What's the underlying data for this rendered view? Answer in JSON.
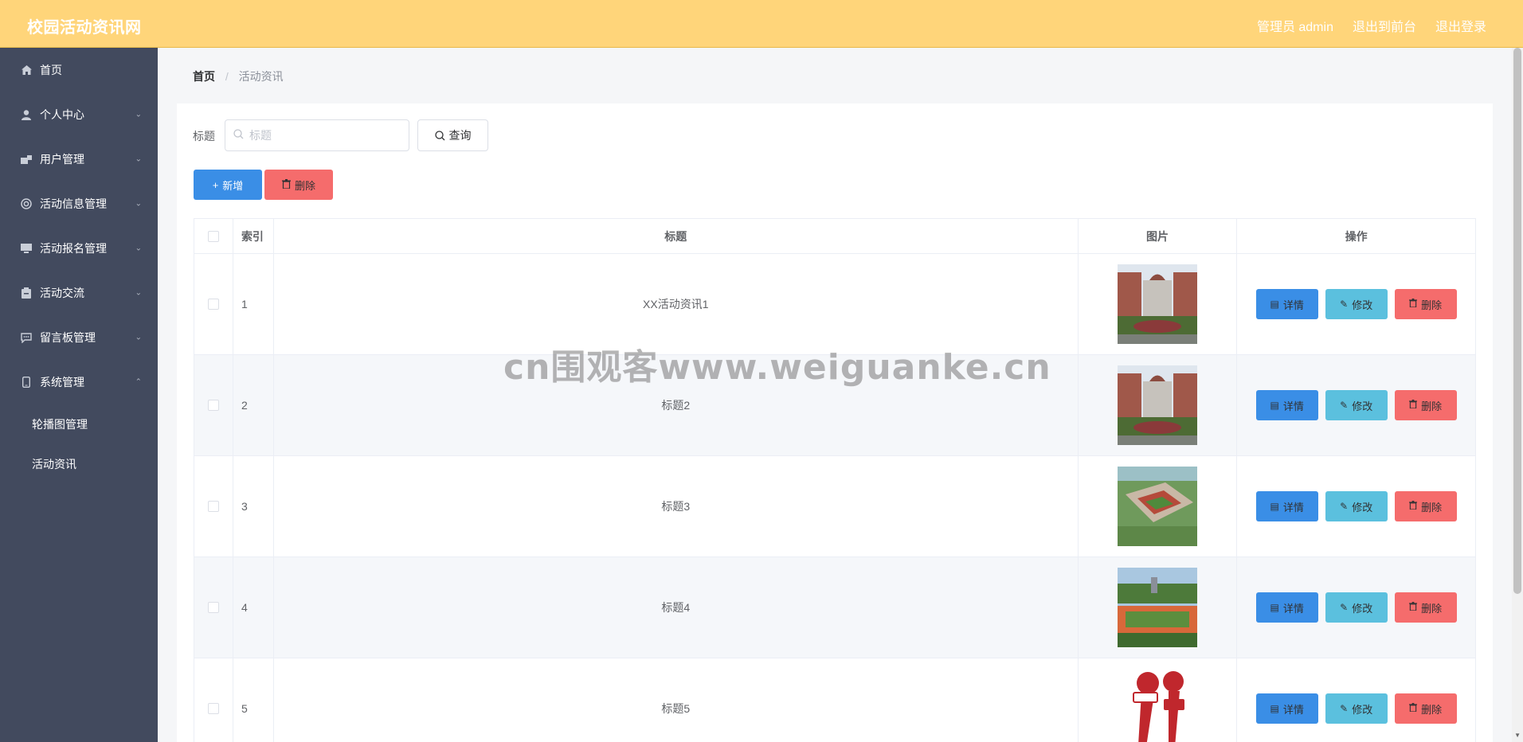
{
  "header": {
    "title": "校园活动资讯网",
    "admin_label": "管理员 admin",
    "front_link": "退出到前台",
    "logout_link": "退出登录"
  },
  "sidebar": {
    "items": [
      {
        "label": "首页",
        "icon": "home-icon",
        "expandable": false
      },
      {
        "label": "个人中心",
        "icon": "user-icon",
        "expandable": true
      },
      {
        "label": "用户管理",
        "icon": "users-icon",
        "expandable": true
      },
      {
        "label": "活动信息管理",
        "icon": "lifebuoy-icon",
        "expandable": true
      },
      {
        "label": "活动报名管理",
        "icon": "monitor-icon",
        "expandable": true
      },
      {
        "label": "活动交流",
        "icon": "clipboard-icon",
        "expandable": true
      },
      {
        "label": "留言板管理",
        "icon": "chat-icon",
        "expandable": true
      },
      {
        "label": "系统管理",
        "icon": "phone-icon",
        "expandable": true,
        "expanded": true
      }
    ],
    "sub_items": [
      {
        "label": "轮播图管理"
      },
      {
        "label": "活动资讯"
      }
    ]
  },
  "breadcrumb": {
    "home": "首页",
    "separator": "/",
    "current": "活动资讯"
  },
  "search": {
    "label": "标题",
    "placeholder": "标题",
    "value": "",
    "query_button": "查询"
  },
  "actions": {
    "add_button": "新增",
    "delete_button": "删除"
  },
  "table": {
    "columns": [
      "索引",
      "标题",
      "图片",
      "操作"
    ],
    "rows": [
      {
        "index": "1",
        "title": "XX活动资讯1",
        "image": "campus-building"
      },
      {
        "index": "2",
        "title": "标题2",
        "image": "campus-building"
      },
      {
        "index": "3",
        "title": "标题3",
        "image": "campus-aerial"
      },
      {
        "index": "4",
        "title": "标题4",
        "image": "sports-field"
      },
      {
        "index": "5",
        "title": "标题5",
        "image": "live-microphones"
      }
    ],
    "ops": {
      "detail": "详情",
      "edit": "修改",
      "delete": "删除"
    }
  },
  "watermark": "cn围观客www.weiguanke.cn",
  "colors": {
    "header_bg": "#ffd57a",
    "sidebar_bg": "#424a5e",
    "primary": "#3a8ee6",
    "info": "#5bc0de",
    "danger": "#f56c6c"
  }
}
